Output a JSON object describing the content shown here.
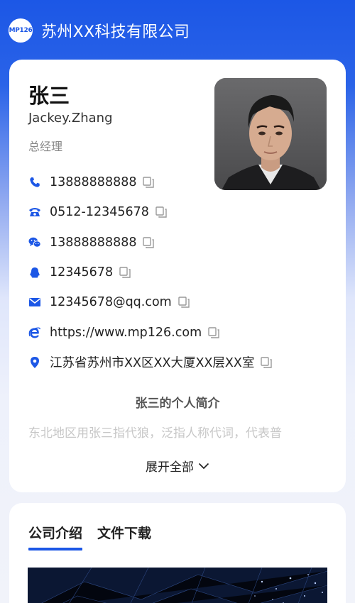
{
  "header": {
    "logo_text": "MP126",
    "company_name": "苏州XX科技有限公司"
  },
  "profile": {
    "name": "张三",
    "english_name": "Jackey.Zhang",
    "title": "总经理"
  },
  "contacts": [
    {
      "icon": "phone-icon",
      "value": "13888888888"
    },
    {
      "icon": "telephone-icon",
      "value": "0512-12345678"
    },
    {
      "icon": "wechat-icon",
      "value": "13888888888"
    },
    {
      "icon": "qq-icon",
      "value": "12345678"
    },
    {
      "icon": "email-icon",
      "value": "12345678@qq.com"
    },
    {
      "icon": "browser-icon",
      "value": "https://www.mp126.com"
    },
    {
      "icon": "location-icon",
      "value": "江苏省苏州市XX区XX大厦XX层XX室"
    }
  ],
  "intro": {
    "title": "张三的个人简介",
    "text": "东北地区用张三指代狼，泛指人称代词，代表普",
    "expand_label": "展开全部"
  },
  "tabs": [
    {
      "label": "公司介绍",
      "active": true
    },
    {
      "label": "文件下载",
      "active": false
    }
  ],
  "colors": {
    "brand": "#1c57e6"
  }
}
